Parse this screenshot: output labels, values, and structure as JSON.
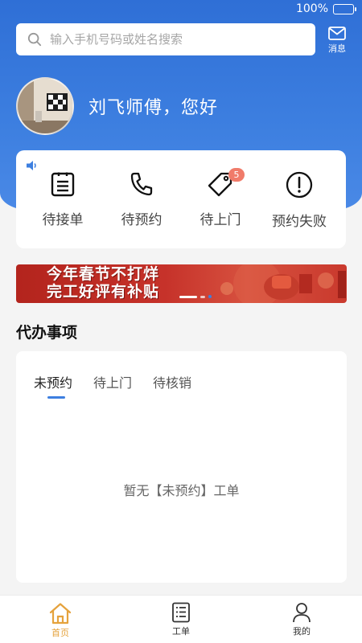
{
  "status_bar": {
    "battery": "100%",
    "battery_level": 1.0
  },
  "search": {
    "placeholder": "输入手机号码或姓名搜索"
  },
  "messages": {
    "label": "消息"
  },
  "profile": {
    "greeting": "刘飞师傅，您好"
  },
  "shortcuts": [
    {
      "label": "待接单",
      "icon": "clipboard-list-icon"
    },
    {
      "label": "待预约",
      "icon": "phone-icon"
    },
    {
      "label": "待上门",
      "icon": "tag-icon",
      "badge": "5"
    },
    {
      "label": "预约失败",
      "icon": "alert-circle-icon"
    }
  ],
  "banner": {
    "line1": "今年春节不打烊",
    "line2": "完工好评有补贴"
  },
  "todo": {
    "title": "代办事项",
    "tabs": [
      "未预约",
      "待上门",
      "待核销"
    ],
    "empty_text": "暂无【未预约】工单"
  },
  "tabbar": [
    {
      "label": "首页",
      "icon": "home-icon",
      "active": true
    },
    {
      "label": "工单",
      "icon": "order-list-icon",
      "active": false
    },
    {
      "label": "我的",
      "icon": "user-icon",
      "active": false
    }
  ],
  "colors": {
    "primary": "#3d7fe0",
    "active_tab": "#e5a23c",
    "badge": "#f07b6a"
  }
}
